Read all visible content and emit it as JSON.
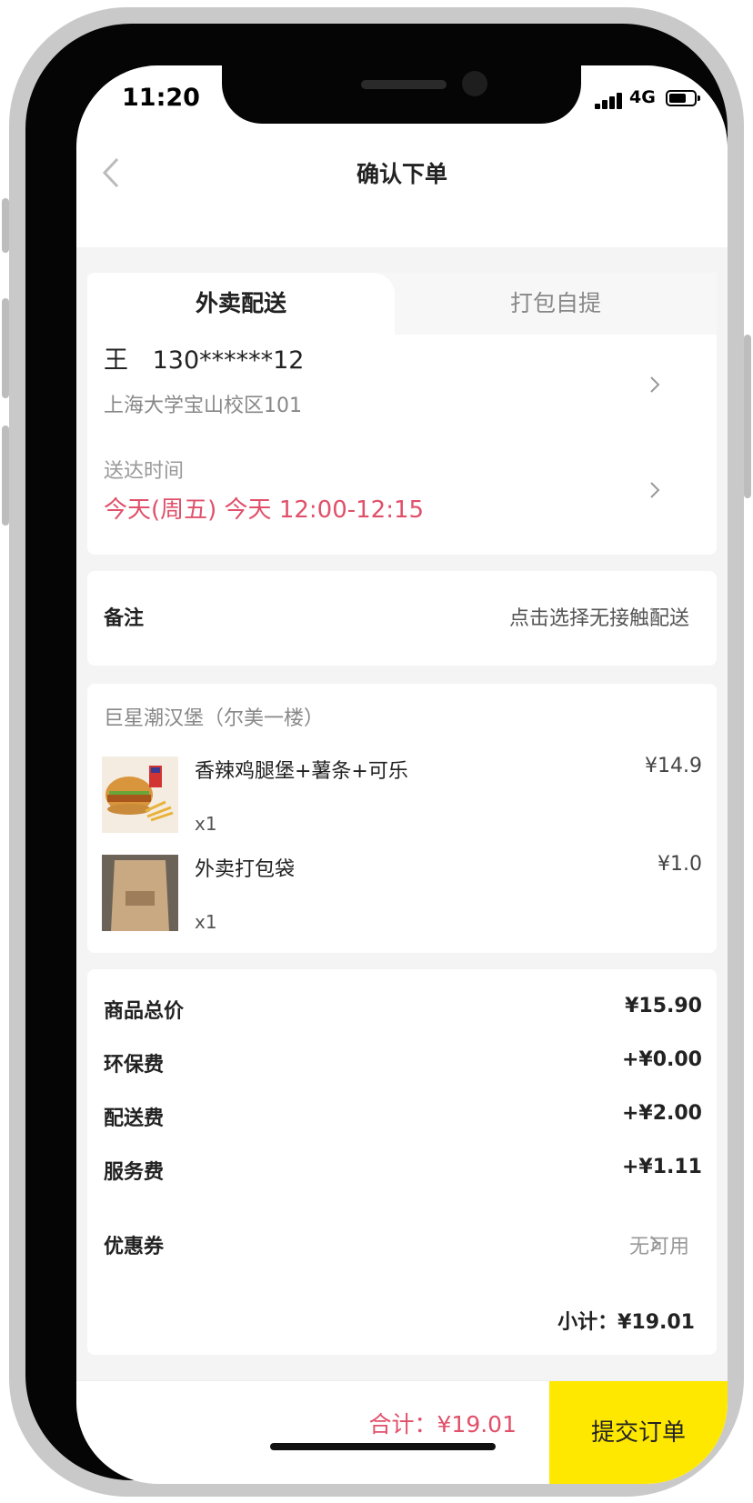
{
  "status": {
    "time": "11:20",
    "network": "4G"
  },
  "nav": {
    "title": "确认下单"
  },
  "tabs": [
    {
      "label": "外卖配送"
    },
    {
      "label": "打包自提"
    }
  ],
  "address": {
    "name": "王",
    "phone": "130******12",
    "detail": "上海大学宝山校区101"
  },
  "delivery": {
    "label": "送达时间",
    "value": "今天(周五) 今天 12:00-12:15"
  },
  "remark": {
    "label": "备注",
    "value": "点击选择无接触配送"
  },
  "store": {
    "name": "巨星潮汉堡（尔美一楼）"
  },
  "items": [
    {
      "name": "香辣鸡腿堡+薯条+可乐",
      "price": "¥14.9",
      "qty": "x1"
    },
    {
      "name": "外卖打包袋",
      "price": "¥1.0",
      "qty": "x1"
    }
  ],
  "fees": [
    {
      "label": "商品总价",
      "value": "¥15.90"
    },
    {
      "label": "环保费",
      "value": "+¥0.00"
    },
    {
      "label": "配送费",
      "value": "+¥2.00"
    },
    {
      "label": "服务费",
      "value": "+¥1.11"
    }
  ],
  "coupon": {
    "label": "优惠券",
    "value": "无可用"
  },
  "subtotal": "小计：¥19.01",
  "footer": {
    "total": "合计：¥19.01",
    "submit_label": "提交订单"
  },
  "colors": {
    "accent": "#ffe800",
    "price_red": "#e0506a"
  }
}
